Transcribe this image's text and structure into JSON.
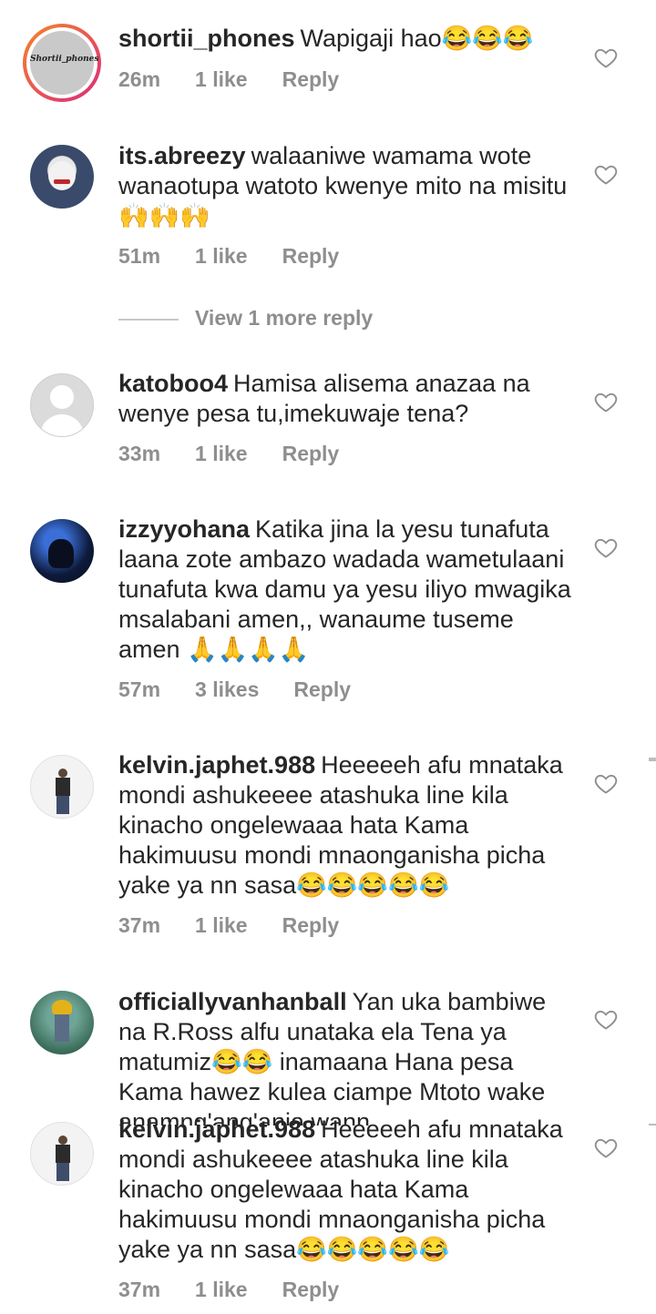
{
  "comments": [
    {
      "username": "shortii_phones",
      "text": "Wapigaji hao😂😂😂",
      "time": "26m",
      "likes": "1 like",
      "reply": "Reply",
      "avatar_text": "Shortii_phones"
    },
    {
      "username": "its.abreezy",
      "text": "walaaniwe wamama wote wanaotupa watoto kwenye mito na misitu 🙌🙌🙌",
      "time": "51m",
      "likes": "1 like",
      "reply": "Reply"
    },
    {
      "username": "katoboo4",
      "text": "Hamisa alisema anazaa na wenye pesa tu,imekuwaje tena?",
      "time": "33m",
      "likes": "1 like",
      "reply": "Reply"
    },
    {
      "username": "izzyyohana",
      "text": "Katika jina la yesu tunafuta laana zote ambazo wadada wametulaani tunafuta kwa damu ya yesu iliyo mwagika msalabani amen,, wanaume tuseme amen 🙏🙏🙏🙏",
      "time": "57m",
      "likes": "3 likes",
      "reply": "Reply"
    },
    {
      "username": "kelvin.japhet.988",
      "text": "Heeeeeh afu mnataka mondi ashukeeee atashuka line kila kinacho ongelewaaa hata Kama hakimuusu mondi mnaonganisha picha yake ya nn sasa😂😂😂😂😂",
      "time": "37m",
      "likes": "1 like",
      "reply": "Reply"
    },
    {
      "username": "officiallyvanhanball",
      "text": "Yan uka bambiwe na R.Ross alfu unataka ela Tena ya matumiz😂😂 inamaana Hana pesa Kama hawez kulea ciampe Mtoto wake anamng'ang'ania wann",
      "time": "",
      "likes": "",
      "reply": ""
    },
    {
      "username": "kelvin.japhet.988",
      "text": "Heeeeeh afu mnataka mondi ashukeeee atashuka line kila kinacho ongelewaaa hata Kama hakimuusu mondi mnaonganisha picha yake ya nn sasa😂😂😂😂😂",
      "time": "37m",
      "likes": "1 like",
      "reply": "Reply"
    }
  ],
  "view_more_replies": "View 1 more reply",
  "colors": {
    "text": "#262626",
    "meta": "#8e8e8e",
    "heart": "#8e8e8e",
    "story_ring_start": "#f58529",
    "story_ring_end": "#dd2a7b"
  },
  "icons": {
    "like": "heart-outline-icon"
  }
}
